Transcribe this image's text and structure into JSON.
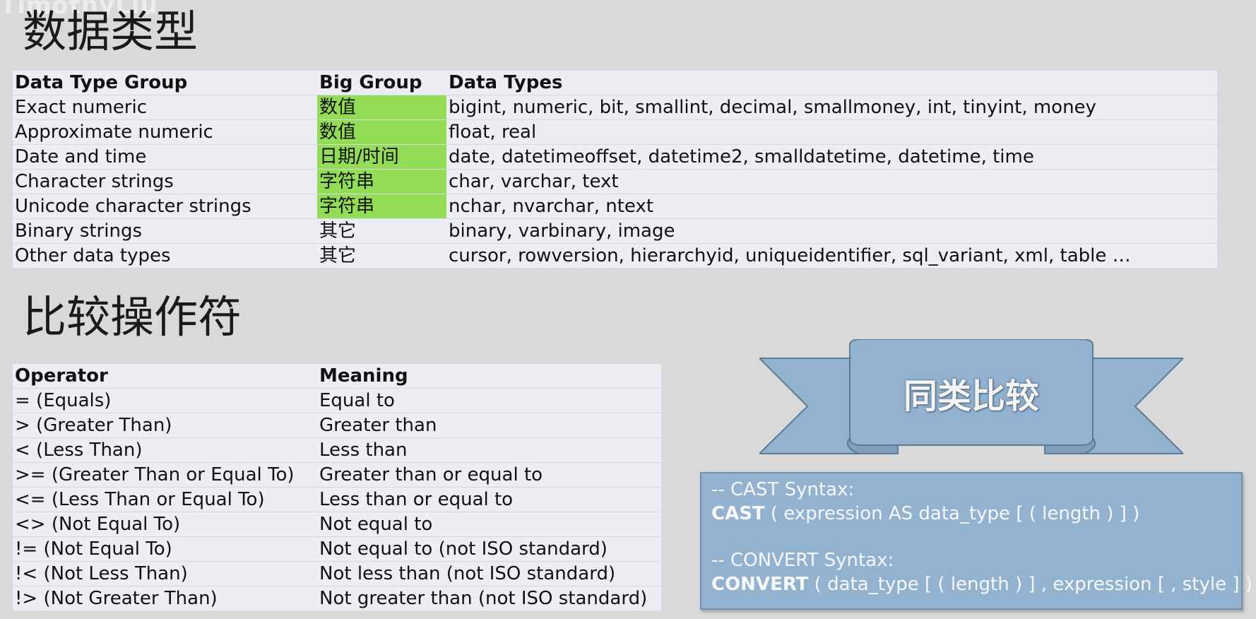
{
  "watermark": "TimothyLiu",
  "data_types": {
    "heading": "数据类型",
    "headers": [
      "Data Type Group",
      "Big Group",
      "Data Types"
    ],
    "rows": [
      {
        "group": "Exact numeric",
        "big": "数值",
        "types": "bigint, numeric, bit, smallint, decimal, smallmoney, int, tinyint, money",
        "highlight": true
      },
      {
        "group": "Approximate numeric",
        "big": "数值",
        "types": "float, real",
        "highlight": true
      },
      {
        "group": "Date and time",
        "big": "日期/时间",
        "types": "date, datetimeoffset, datetime2, smalldatetime, datetime, time",
        "highlight": true
      },
      {
        "group": "Character strings",
        "big": "字符串",
        "types": "char, varchar, text",
        "highlight": true
      },
      {
        "group": "Unicode character strings",
        "big": "字符串",
        "types": "nchar, nvarchar, ntext",
        "highlight": true
      },
      {
        "group": "Binary strings",
        "big": "其它",
        "types": "binary, varbinary, image",
        "highlight": false
      },
      {
        "group": "Other data types",
        "big": "其它",
        "types": "cursor, rowversion, hierarchyid, uniqueidentifier, sql_variant, xml, table …",
        "highlight": false
      }
    ],
    "highlight_color": "#92dd55"
  },
  "operators": {
    "heading": "比较操作符",
    "headers": [
      "Operator",
      "Meaning"
    ],
    "rows": [
      {
        "op": "= (Equals)",
        "meaning": "Equal to"
      },
      {
        "op": "> (Greater Than)",
        "meaning": "Greater than"
      },
      {
        "op": "< (Less Than)",
        "meaning": "Less than"
      },
      {
        "op": ">= (Greater Than or Equal To)",
        "meaning": "Greater than or equal to"
      },
      {
        "op": "<= (Less Than or Equal To)",
        "meaning": "Less than or equal to"
      },
      {
        "op": "<> (Not Equal To)",
        "meaning": "Not equal to"
      },
      {
        "op": "!= (Not Equal To)",
        "meaning": "Not equal to (not ISO standard)"
      },
      {
        "op": "!< (Not Less Than)",
        "meaning": "Not less than (not ISO standard)"
      },
      {
        "op": "!> (Not Greater Than)",
        "meaning": "Not greater than (not ISO standard)"
      }
    ]
  },
  "banner": {
    "text": "同类比较",
    "color": "#93b2d0"
  },
  "syntax": {
    "cast_comment": "-- CAST Syntax:",
    "cast_keyword": "CAST",
    "cast_rest": " ( expression AS data_type [ ( length ) ] )",
    "convert_comment": "-- CONVERT Syntax:",
    "convert_keyword": "CONVERT",
    "convert_rest": " ( data_type [ ( length ) ] , expression [ , style ] )"
  }
}
